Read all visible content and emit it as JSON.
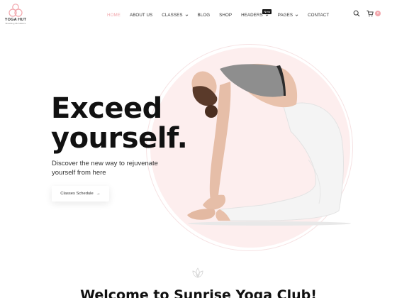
{
  "brand": {
    "name": "YOGA HUT",
    "tagline": "Breathing life balance"
  },
  "nav": {
    "items": [
      {
        "label": "HOME",
        "active": true
      },
      {
        "label": "ABOUT US"
      },
      {
        "label": "CLASSES",
        "dropdown": true
      },
      {
        "label": "BLOG"
      },
      {
        "label": "SHOP"
      },
      {
        "label": "HEADERS",
        "dropdown": true,
        "badge": "New"
      },
      {
        "label": "PAGES",
        "dropdown": true
      },
      {
        "label": "CONTACT"
      }
    ]
  },
  "header_icons": {
    "search": "search-icon",
    "cart": "cart-icon",
    "cart_count": "0"
  },
  "hero": {
    "title_line1": "Exceed",
    "title_line2": "yourself.",
    "subtitle": "Discover the new way to rejuvenate yourself from here",
    "cta_label": "Classes Schedule",
    "cta_arrow": "→"
  },
  "section": {
    "welcome_title": "Welcome to Sunrise Yoga Club!"
  },
  "colors": {
    "accent": "#f2a7ad",
    "circle": "#fdeeee",
    "text": "#111111"
  }
}
